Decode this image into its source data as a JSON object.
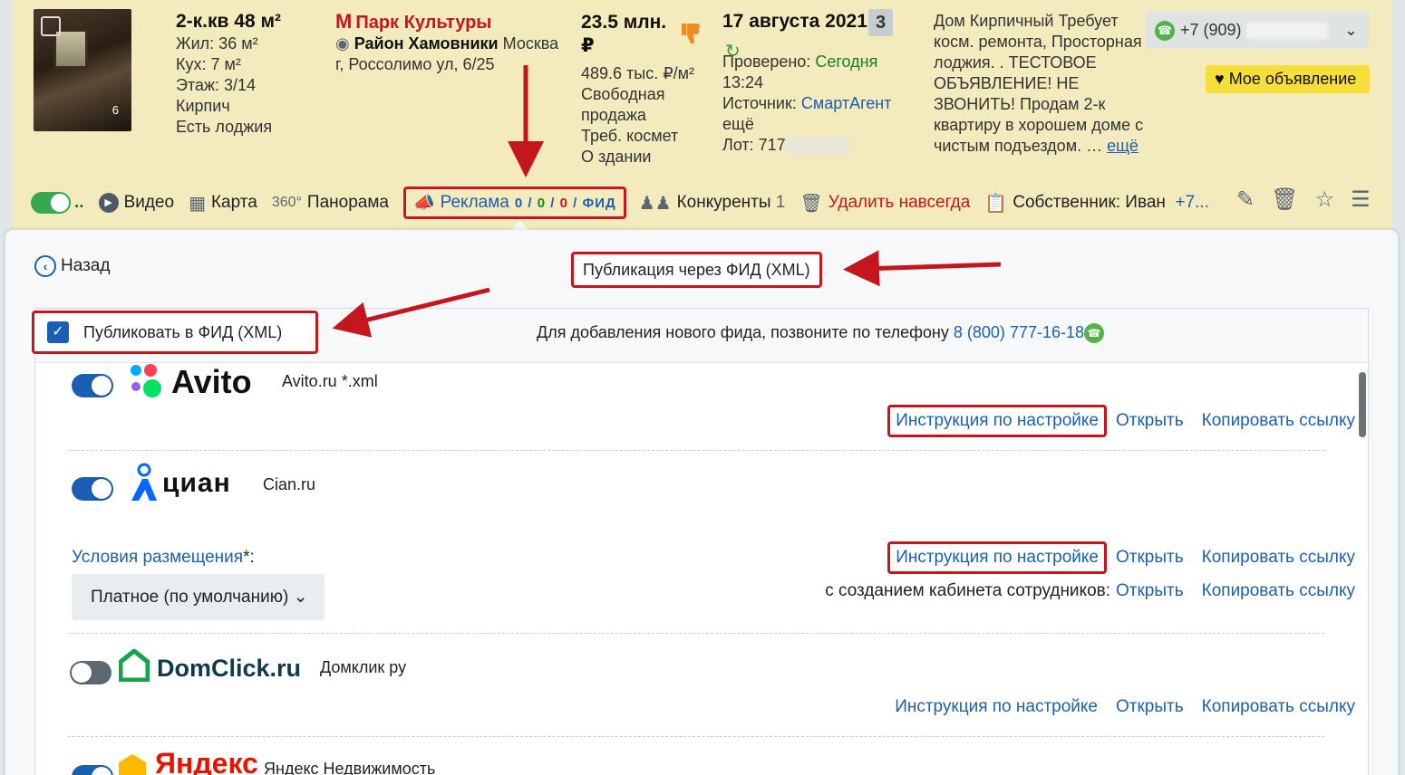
{
  "listing": {
    "title": "2-к.кв 48 м²",
    "photo_count": "6",
    "living": "Жил: 36 м²",
    "kitchen": "Кух: 7 м²",
    "floor": "Этаж: 3/14",
    "material": "Кирпич",
    "extra": "Есть лоджия",
    "metro_icon": "М",
    "metro": "Парк Культуры",
    "district": "Район Хамовники",
    "city": "Москва",
    "address": "г, Россолимо ул, 6/25",
    "price": "23.5 млн.",
    "currency": "₽",
    "price_per_m": "489.6 тыс. ₽/м²",
    "sale_type_1": "Свободная",
    "sale_type_2": "продажа",
    "condition": "Треб. космет",
    "building": "О здании",
    "date": "17 августа 2021",
    "date_badge": "3",
    "checked_label": "Проверено:",
    "checked_value": "Сегодня",
    "checked_time": "13:24",
    "source_label": "Источник:",
    "source_value": "СмартАгент",
    "source_more": "ещё",
    "lot": "Лот: 717",
    "description": "Дом Кирпичный Требует косм. ремонта, Просторная лоджия. . ТЕСТОВОЕ ОБЪЯВЛЕНИЕ! НЕ ЗВОНИТЬ! Продам 2-к квартиру в хорошем доме с чистым подъездом. …",
    "description_more": "ещё",
    "phone": "+7 (909)",
    "my_ad": "Мое объявление"
  },
  "toolbar": {
    "dots": "..",
    "video": "Видео",
    "map": "Карта",
    "panorama_icon": "360°",
    "panorama": "Панорама",
    "ads": "Реклама",
    "ads_c1": "0",
    "ads_c2": "0",
    "ads_c3": "0",
    "ads_feed": "ФИД",
    "competitors": "Конкуренты",
    "competitors_count": "1",
    "delete": "Удалить навсегда",
    "owner": "Собственник: Иван",
    "owner_phone": "+7..."
  },
  "panel": {
    "back": "Назад",
    "title": "Публикация через ФИД (XML)",
    "publish_checkbox": "Публиковать в ФИД (XML)",
    "note": "Для добавления нового фида, позвоните по телефону",
    "note_phone": "8 (800) 777-16-18"
  },
  "feeds": [
    {
      "logo": "Avito",
      "site": "Avito.ru *.xml",
      "enabled": true
    },
    {
      "logo": "циан",
      "site": "Cian.ru",
      "enabled": true
    },
    {
      "logo": "DomClick.ru",
      "site": "Домклик ру",
      "enabled": false
    },
    {
      "logo": "Яндекс",
      "site": "Яндекс Недвижимость",
      "enabled": true
    }
  ],
  "links": {
    "instruction": "Инструкция по настройке",
    "open": "Открыть",
    "copy": "Копировать ссылку"
  },
  "cian": {
    "conditions": "Условия размещения",
    "conditions_star": "*:",
    "select_value": "Платное (по умолчанию)",
    "employees_label": "с созданием кабинета сотрудников:"
  },
  "colors": {
    "card_bg": "#f3ebbd",
    "accent_red": "#c4161c",
    "link_blue": "#1a5fb4",
    "toggle_on": "#1a5fb4",
    "toggle_green": "#34a853"
  }
}
